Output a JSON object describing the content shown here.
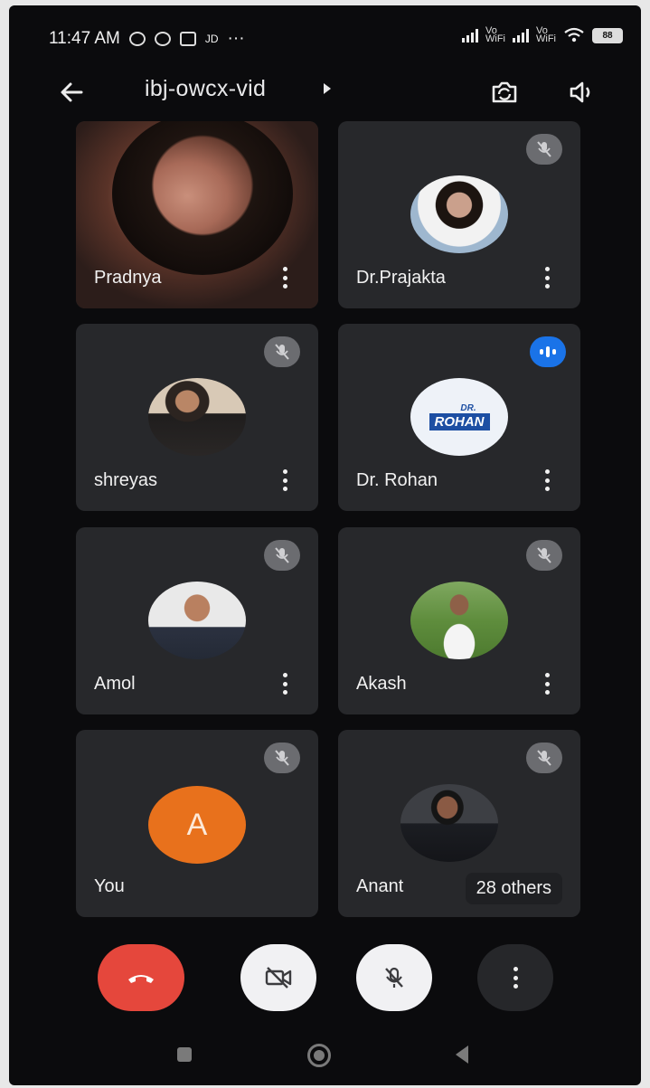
{
  "status_bar": {
    "time": "11:47 AM",
    "extra": "JD",
    "dots": "···",
    "vowifi_1": "Vo WiFi",
    "vowifi_2": "Vo WiFi",
    "battery": "88"
  },
  "header": {
    "meeting_code": "ibj-owcx-vid"
  },
  "participants": [
    {
      "name": "Pradnya",
      "state": "video"
    },
    {
      "name": "Dr.Prajakta",
      "state": "muted"
    },
    {
      "name": "shreyas",
      "state": "muted"
    },
    {
      "name": "Dr. Rohan",
      "state": "speaking",
      "logo_top": "DR.",
      "logo_main": "ROHAN"
    },
    {
      "name": "Amol",
      "state": "muted"
    },
    {
      "name": "Akash",
      "state": "muted"
    },
    {
      "name": "You",
      "state": "muted",
      "avatar_letter": "A"
    },
    {
      "name": "Anant",
      "state": "muted",
      "others": "28 others"
    }
  ],
  "colors": {
    "end_call": "#e5473c",
    "speaking_badge": "#1a73e8",
    "you_avatar": "#e8711c"
  }
}
